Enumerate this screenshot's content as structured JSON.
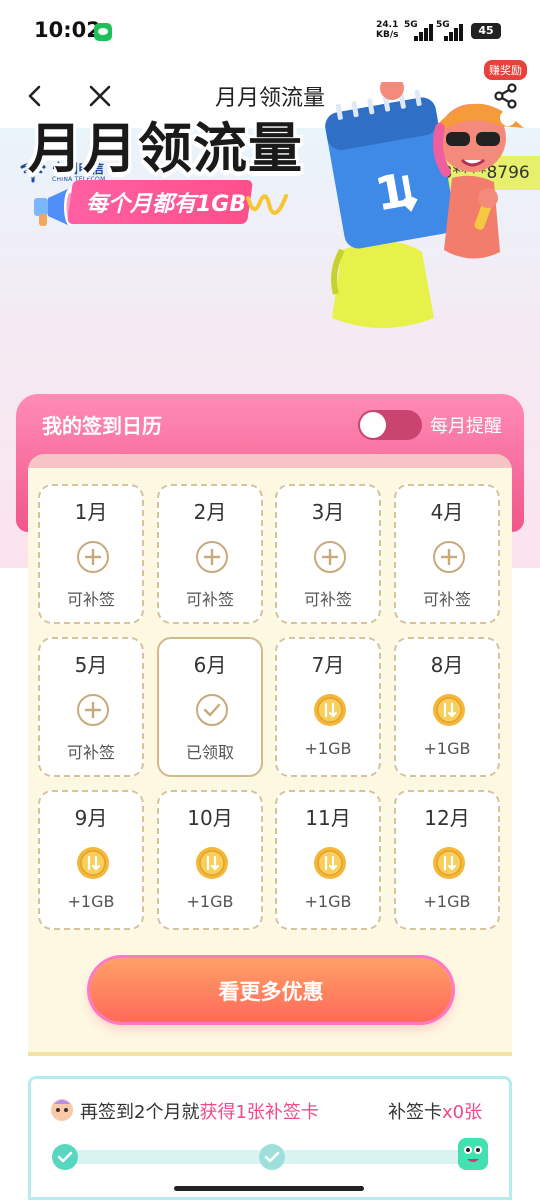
{
  "status": {
    "time": "10:02",
    "net_speed": "24.1",
    "net_unit": "KB/s",
    "sig1": "5G",
    "sig2": "5G",
    "battery": "45"
  },
  "nav": {
    "title": "月月领流量",
    "reward_badge": "赚奖励"
  },
  "hero": {
    "logo_cn": "中国电信",
    "logo_en": "CHINA TELECOM",
    "phone": "173****8796",
    "title": "月月领流量",
    "subtitle": "每个月都有1GB"
  },
  "calendar": {
    "title": "我的签到日历",
    "remind_label": "每月提醒",
    "remind_on": false,
    "months": [
      {
        "month": "1月",
        "status": "可补签",
        "state": "makeup"
      },
      {
        "month": "2月",
        "status": "可补签",
        "state": "makeup"
      },
      {
        "month": "3月",
        "status": "可补签",
        "state": "makeup"
      },
      {
        "month": "4月",
        "status": "可补签",
        "state": "makeup"
      },
      {
        "month": "5月",
        "status": "可补签",
        "state": "makeup"
      },
      {
        "month": "6月",
        "status": "已领取",
        "state": "claimed"
      },
      {
        "month": "7月",
        "status": "+1GB",
        "state": "reward"
      },
      {
        "month": "8月",
        "status": "+1GB",
        "state": "reward"
      },
      {
        "month": "9月",
        "status": "+1GB",
        "state": "reward"
      },
      {
        "month": "10月",
        "status": "+1GB",
        "state": "reward"
      },
      {
        "month": "11月",
        "status": "+1GB",
        "state": "reward"
      },
      {
        "month": "12月",
        "status": "+1GB",
        "state": "reward"
      }
    ],
    "button_label": "看更多优惠"
  },
  "progress": {
    "text_prefix": "再签到2个月就",
    "text_highlight": "获得1张补签卡",
    "card_label": "补签卡",
    "card_count": "x0张"
  },
  "colors": {
    "accent_pink": "#f04a8a",
    "phone_bg": "#e6f06a",
    "gold": "#f3b73a"
  }
}
